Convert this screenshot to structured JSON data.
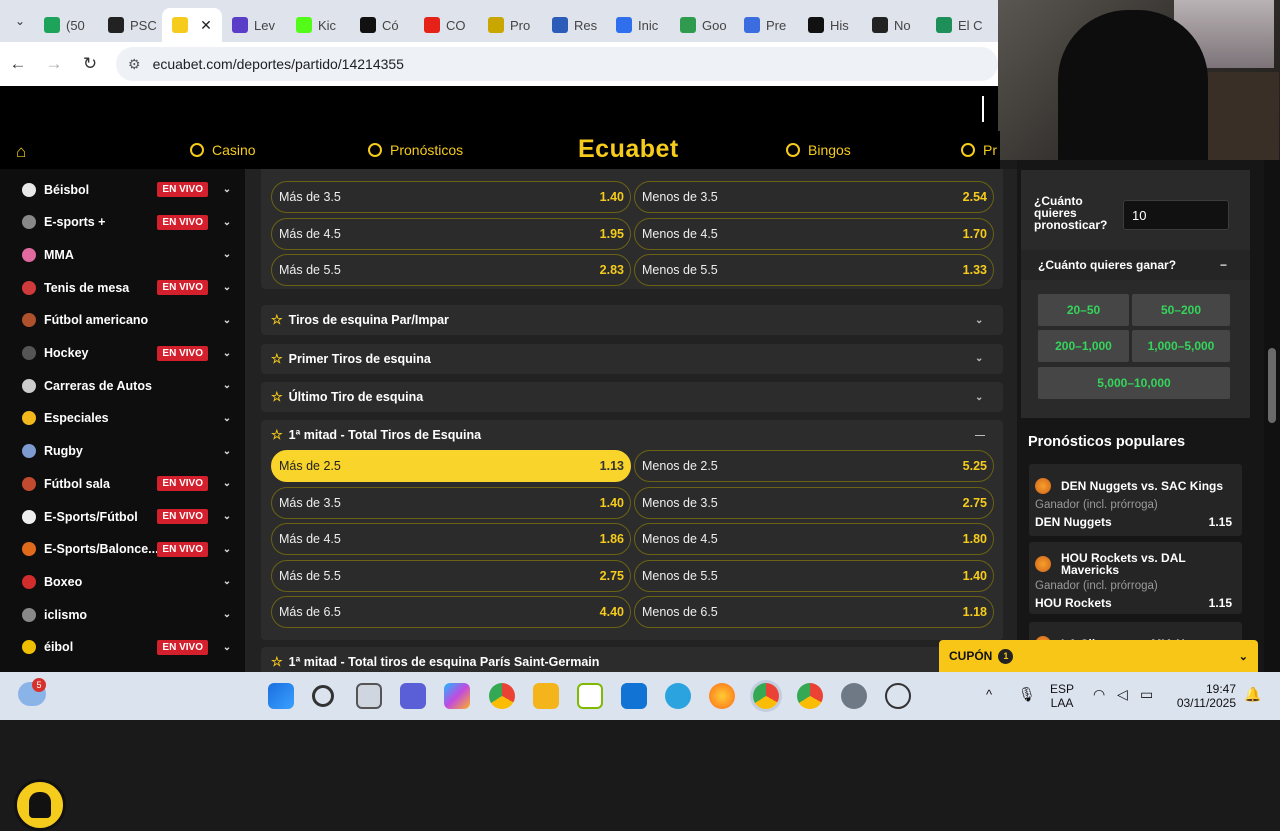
{
  "browser": {
    "tabs": [
      {
        "label": "(50",
        "color": "#1ea45a"
      },
      {
        "label": "PSC",
        "color": "#222222"
      },
      {
        "label": "",
        "color": "#f5cb1c",
        "active": true
      },
      {
        "label": "Lev",
        "color": "#5b3ec8"
      },
      {
        "label": "Kic",
        "color": "#53fc18"
      },
      {
        "label": "Có",
        "color": "#111111"
      },
      {
        "label": "CO",
        "color": "#e62117"
      },
      {
        "label": "Pro",
        "color": "#c9a600"
      },
      {
        "label": "Res",
        "color": "#2b5db8"
      },
      {
        "label": "Inic",
        "color": "#2f6fed"
      },
      {
        "label": "Goo",
        "color": "#2e9b4f"
      },
      {
        "label": "Pre",
        "color": "#3b6de0"
      },
      {
        "label": "His",
        "color": "#111111"
      },
      {
        "label": "No",
        "color": "#222222"
      },
      {
        "label": "El C",
        "color": "#1f8f5a"
      }
    ],
    "url": "ecuabet.com/deportes/partido/14214355"
  },
  "site": {
    "logo": "Ecuabet",
    "nav": {
      "casino": "Casino",
      "pronosticos": "Pronósticos",
      "bingos": "Bingos",
      "pr": "Pr"
    }
  },
  "sidebar": {
    "items": [
      {
        "label": "Béisbol",
        "live": "EN VIVO",
        "icon_color": "#e8e8e8"
      },
      {
        "label": "E-sports +",
        "live": "EN VIVO",
        "icon_color": "#888888"
      },
      {
        "label": "MMA",
        "live": "",
        "icon_color": "#e06aa0"
      },
      {
        "label": "Tenis de mesa",
        "live": "EN VIVO",
        "icon_color": "#d03a3a"
      },
      {
        "label": "Fútbol americano",
        "live": "",
        "icon_color": "#b0512e"
      },
      {
        "label": "Hockey",
        "live": "EN VIVO",
        "icon_color": "#555555"
      },
      {
        "label": "Carreras de Autos",
        "live": "",
        "icon_color": "#cccccc"
      },
      {
        "label": "Especiales",
        "live": "",
        "icon_color": "#f2b81c"
      },
      {
        "label": "Rugby",
        "live": "",
        "icon_color": "#7e9bd0"
      },
      {
        "label": "Fútbol sala",
        "live": "EN VIVO",
        "icon_color": "#c24a2f"
      },
      {
        "label": "E-Sports/Fútbol",
        "live": "EN VIVO",
        "icon_color": "#eeeeee"
      },
      {
        "label": "E-Sports/Balonce...",
        "live": "EN VIVO",
        "icon_color": "#e06a1c"
      },
      {
        "label": "Boxeo",
        "live": "",
        "icon_color": "#d12d2d"
      },
      {
        "label": "iclismo",
        "live": "",
        "icon_color": "#888888"
      },
      {
        "label": "éibol",
        "live": "EN VIVO",
        "icon_color": "#f0c000"
      }
    ]
  },
  "markets": {
    "top_group": [
      {
        "over": "Más de 3.5",
        "over_odd": "1.40",
        "under": "Menos de 3.5",
        "under_odd": "2.54"
      },
      {
        "over": "Más de 4.5",
        "over_odd": "1.95",
        "under": "Menos de 4.5",
        "under_odd": "1.70"
      },
      {
        "over": "Más de 5.5",
        "over_odd": "2.83",
        "under": "Menos de 5.5",
        "under_odd": "1.33"
      }
    ],
    "collapsed": [
      {
        "title": "Tiros de esquina Par/Impar"
      },
      {
        "title": "Primer Tiros de esquina"
      },
      {
        "title": "Último Tiro de esquina"
      }
    ],
    "first_half_title": "1ª mitad - Total Tiros de Esquina",
    "first_half": [
      {
        "over": "Más de 2.5",
        "over_odd": "1.13",
        "under": "Menos de 2.5",
        "under_odd": "5.25"
      },
      {
        "over": "Más de 3.5",
        "over_odd": "1.40",
        "under": "Menos de 3.5",
        "under_odd": "2.75"
      },
      {
        "over": "Más de 4.5",
        "over_odd": "1.86",
        "under": "Menos de 4.5",
        "under_odd": "1.80"
      },
      {
        "over": "Más de 5.5",
        "over_odd": "2.75",
        "under": "Menos de 5.5",
        "under_odd": "1.40"
      },
      {
        "over": "Más de 6.5",
        "over_odd": "4.40",
        "under": "Menos de 6.5",
        "under_odd": "1.18"
      }
    ],
    "next_title": "1ª mitad - Total tiros de esquina París Saint-Germain"
  },
  "betslip": {
    "question": "¿Cuánto quieres pronosticar?",
    "stake": "10",
    "win_question": "¿Cuánto quieres ganar?",
    "collapse": "−",
    "ranges": [
      "20–50",
      "50–200",
      "200–1,000",
      "1,000–5,000",
      "5,000–10,000"
    ]
  },
  "popular": {
    "title": "Pronósticos populares",
    "items": [
      {
        "match": "DEN Nuggets vs. SAC Kings",
        "market": "Ganador (incl. prórroga)",
        "selection": "DEN Nuggets",
        "odd": "1.15"
      },
      {
        "match": "HOU Rockets vs. DAL Mavericks",
        "market": "Ganador (incl. prórroga)",
        "selection": "HOU Rockets",
        "odd": "1.15"
      },
      {
        "match": "LA Clippers vs. MIA Heat"
      }
    ]
  },
  "coupon": {
    "label": "CUPÓN",
    "count": "1"
  },
  "taskbar": {
    "weather_badge": "5",
    "lang_top": "ESP",
    "lang_bottom": "LAA",
    "time": "19:47",
    "date": "03/11/2025"
  }
}
